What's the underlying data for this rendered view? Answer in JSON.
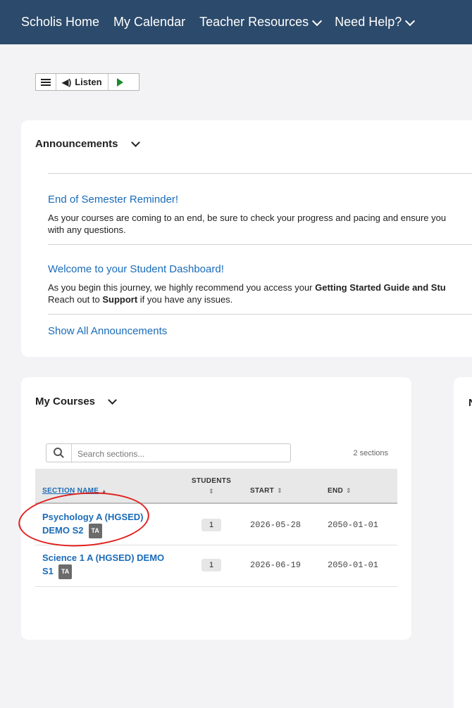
{
  "topnav": {
    "items": [
      {
        "label": "Scholis Home",
        "has_dropdown": false
      },
      {
        "label": "My Calendar",
        "has_dropdown": false
      },
      {
        "label": "Teacher Resources",
        "has_dropdown": true
      },
      {
        "label": "Need Help?",
        "has_dropdown": true
      }
    ],
    "bg_color": "#2c4a6b"
  },
  "listen_toolbar": {
    "listen_label": "Listen"
  },
  "announcements": {
    "title": "Announcements",
    "items": [
      {
        "title": "End of Semester Reminder!",
        "body_line1": "As your courses are coming to an end, be sure to check your progress and pacing and ensure you",
        "body_line2": "with any questions."
      },
      {
        "title": "Welcome to your Student Dashboard!",
        "body_line1_pre": "As you begin this journey, we highly recommend you access your ",
        "body_line1_bold": "Getting Started Guide and Stu",
        "body_line2_pre": "Reach out to ",
        "body_line2_bold": "Support",
        "body_line2_post": " if you have any issues."
      }
    ],
    "show_all_label": "Show All Announcements"
  },
  "courses": {
    "title": "My Courses",
    "search_placeholder": "Search sections...",
    "sections_count": "2 sections",
    "columns": {
      "name": "SECTION NAME",
      "students_line1": "STUDENTS",
      "start": "START",
      "end": "END"
    },
    "sort_asc": "▲",
    "sort_both": "⇕",
    "rows": [
      {
        "name_line1": "Psychology A (HGSED)",
        "name_line2": "DEMO S2",
        "badge": "TA",
        "students": "1",
        "start": "2026-05-28",
        "end": "2050-01-01"
      },
      {
        "name_line1": "Science 1 A (HGSED) DEMO",
        "name_line2": "S1",
        "badge": "TA",
        "students": "1",
        "start": "2026-06-19",
        "end": "2050-01-01"
      }
    ]
  },
  "right_panel": {
    "heading_initial": "N"
  },
  "annotation_color": "#e0201c"
}
